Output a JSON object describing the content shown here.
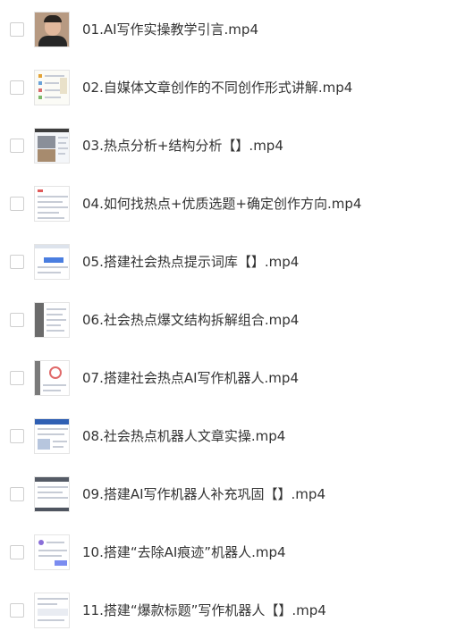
{
  "files": [
    {
      "name": "01.AI写作实操教学引言.mp4",
      "thumb": "person-thumbnail"
    },
    {
      "name": "02.自媒体文章创作的不同创作形式讲解.mp4",
      "thumb": "document-thumbnail"
    },
    {
      "name": "03.热点分析+结构分析【】.mp4",
      "thumb": "screenshot-thumbnail"
    },
    {
      "name": "04.如何找热点+优质选题+确定创作方向.mp4",
      "thumb": "screenshot-thumbnail"
    },
    {
      "name": "05.搭建社会热点提示词库【】.mp4",
      "thumb": "screenshot-thumbnail"
    },
    {
      "name": "06.社会热点爆文结构拆解组合.mp4",
      "thumb": "screenshot-thumbnail"
    },
    {
      "name": "07.搭建社会热点AI写作机器人.mp4",
      "thumb": "screenshot-thumbnail"
    },
    {
      "name": "08.社会热点机器人文章实操.mp4",
      "thumb": "screenshot-thumbnail"
    },
    {
      "name": "09.搭建AI写作机器人补充巩固【】.mp4",
      "thumb": "screenshot-thumbnail"
    },
    {
      "name": "10.搭建“去除AI痕迹”机器人.mp4",
      "thumb": "screenshot-thumbnail"
    },
    {
      "name": "11.搭建“爆款标题”写作机器人【】.mp4",
      "thumb": "screenshot-thumbnail"
    }
  ],
  "colors": {
    "text": "#333333",
    "checkbox_border": "#cfcfcf",
    "background": "#ffffff"
  }
}
